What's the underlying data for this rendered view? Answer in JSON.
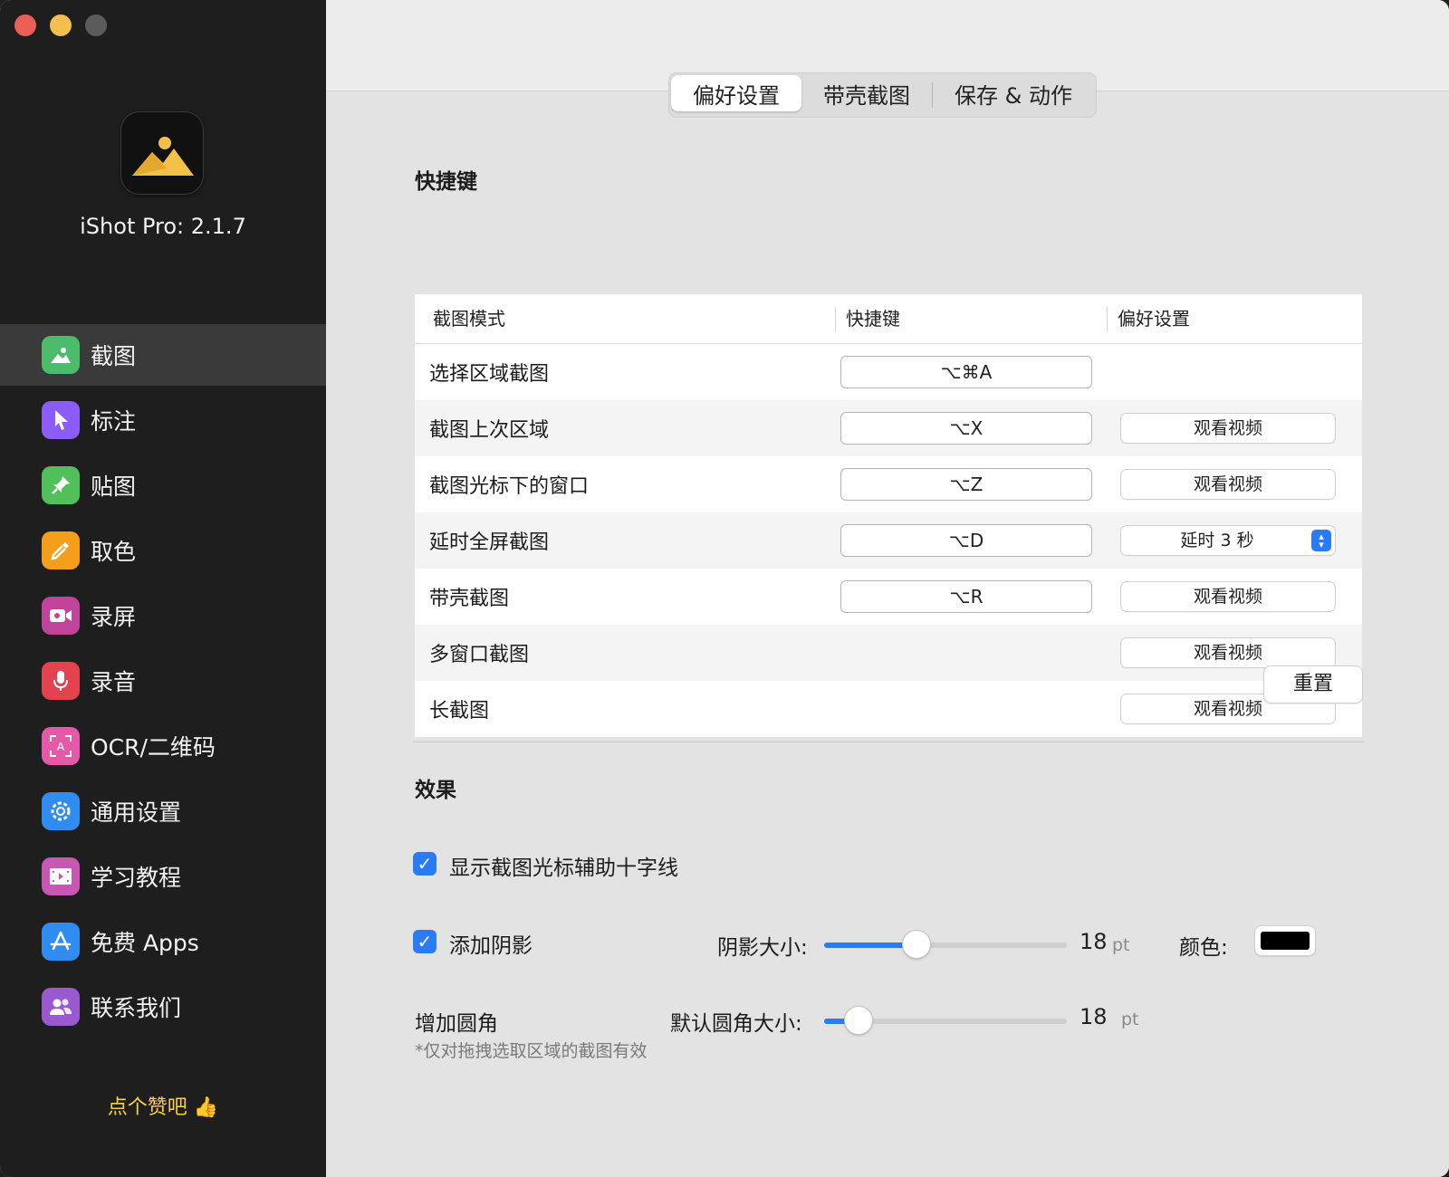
{
  "app": {
    "title": "iShot Pro: 2.1.7",
    "like_text": "点个赞吧 👍"
  },
  "sidebar": {
    "items": [
      {
        "label": "截图",
        "icon": "image-icon",
        "color": "#4cbc6c",
        "active": true
      },
      {
        "label": "标注",
        "icon": "cursor-icon",
        "color": "#8b5cf6",
        "active": false
      },
      {
        "label": "贴图",
        "icon": "pin-icon",
        "color": "#52c05a",
        "active": false
      },
      {
        "label": "取色",
        "icon": "eyedropper-icon",
        "color": "#f59e1b",
        "active": false
      },
      {
        "label": "录屏",
        "icon": "video-camera-icon",
        "color": "#c0459a",
        "active": false
      },
      {
        "label": "录音",
        "icon": "microphone-icon",
        "color": "#e3424f",
        "active": false
      },
      {
        "label": "OCR/二维码",
        "icon": "ocr-scan-icon",
        "color": "#e55aa8",
        "active": false
      },
      {
        "label": "通用设置",
        "icon": "gear-icon",
        "color": "#2f8cf0",
        "active": false
      },
      {
        "label": "学习教程",
        "icon": "film-icon",
        "color": "#c857b4",
        "active": false
      },
      {
        "label": "免费 Apps",
        "icon": "app-store-icon",
        "color": "#2f8cf0",
        "active": false
      },
      {
        "label": "联系我们",
        "icon": "people-icon",
        "color": "#9b59d0",
        "active": false
      }
    ]
  },
  "tabs": [
    {
      "label": "偏好设置",
      "active": true
    },
    {
      "label": "带壳截图",
      "active": false
    },
    {
      "label": "保存 & 动作",
      "active": false
    }
  ],
  "shortcuts": {
    "title": "快捷键",
    "headers": [
      "截图模式",
      "快捷键",
      "偏好设置"
    ],
    "rows": [
      {
        "mode": "选择区域截图",
        "hotkey": "⌥⌘A",
        "pref": "",
        "pref_type": "none"
      },
      {
        "mode": "截图上次区域",
        "hotkey": "⌥X",
        "pref": "观看视频",
        "pref_type": "button"
      },
      {
        "mode": "截图光标下的窗口",
        "hotkey": "⌥Z",
        "pref": "观看视频",
        "pref_type": "button"
      },
      {
        "mode": "延时全屏截图",
        "hotkey": "⌥D",
        "pref": "延时 3 秒",
        "pref_type": "select"
      },
      {
        "mode": "带壳截图",
        "hotkey": "⌥R",
        "pref": "观看视频",
        "pref_type": "button"
      },
      {
        "mode": "多窗口截图",
        "hotkey": "",
        "pref": "观看视频",
        "pref_type": "button"
      },
      {
        "mode": "长截图",
        "hotkey": "",
        "pref": "观看视频",
        "pref_type": "button"
      }
    ],
    "reset_label": "重置"
  },
  "effects": {
    "title": "效果",
    "crosshair": {
      "label": "显示截图光标辅助十字线",
      "checked": true
    },
    "shadow": {
      "label": "添加阴影",
      "checked": true,
      "size_label": "阴影大小:",
      "value": "18",
      "unit": "pt",
      "fraction": 0.38,
      "color_label": "颜色:",
      "color": "#000000"
    },
    "corner": {
      "label": "增加圆角",
      "size_label": "默认圆角大小:",
      "value": "18",
      "unit": "pt",
      "fraction": 0.14,
      "note": "*仅对拖拽选取区域的截图有效"
    }
  },
  "accent_color": "#2a7cf6"
}
